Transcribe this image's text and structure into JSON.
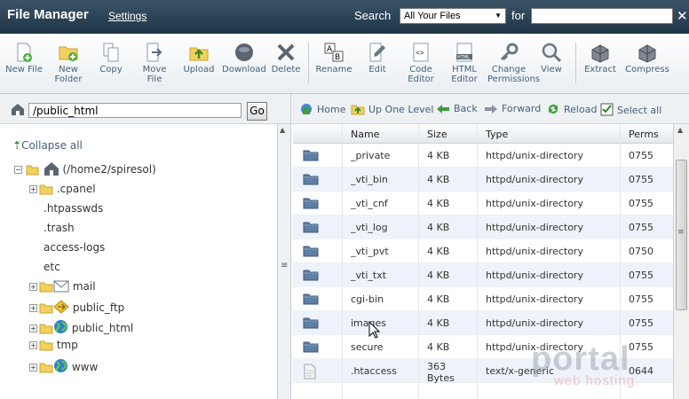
{
  "header": {
    "title": "File Manager",
    "settings": "Settings",
    "search_label": "Search",
    "search_scope": "All Your Files",
    "for_label": "for",
    "search_value": ""
  },
  "toolbar": [
    {
      "name": "new-file-button",
      "label": "New File",
      "icon": "new-file-icon"
    },
    {
      "name": "new-folder-button",
      "label": "New Folder",
      "icon": "new-folder-icon"
    },
    {
      "name": "copy-button",
      "label": "Copy",
      "icon": "copy-icon"
    },
    {
      "name": "move-file-button",
      "label": "Move File",
      "icon": "move-icon"
    },
    {
      "name": "upload-button",
      "label": "Upload",
      "icon": "upload-icon"
    },
    {
      "name": "download-button",
      "label": "Download",
      "icon": "download-icon"
    },
    {
      "name": "delete-button",
      "label": "Delete",
      "icon": "delete-icon"
    },
    {
      "name": "rename-button",
      "label": "Rename",
      "icon": "rename-icon"
    },
    {
      "name": "edit-button",
      "label": "Edit",
      "icon": "edit-icon"
    },
    {
      "name": "code-editor-button",
      "label": "Code Editor",
      "icon": "code-editor-icon"
    },
    {
      "name": "html-editor-button",
      "label": "HTML Editor",
      "icon": "html-editor-icon"
    },
    {
      "name": "change-permissions-button",
      "label": "Change Permissions",
      "icon": "key-icon"
    },
    {
      "name": "view-button",
      "label": "View",
      "icon": "magnifier-icon"
    },
    {
      "name": "extract-button",
      "label": "Extract",
      "icon": "extract-icon"
    },
    {
      "name": "compress-button",
      "label": "Compress",
      "icon": "compress-icon"
    }
  ],
  "pathbar": {
    "path": "/public_html",
    "go": "Go"
  },
  "nav": {
    "home": "Home",
    "up": "Up One Level",
    "back": "Back",
    "forward": "Forward",
    "reload": "Reload",
    "select_all": "Select all"
  },
  "tree": {
    "collapse_all": "Collapse all",
    "root": "(/home2/spiresol)",
    "items": [
      {
        "label": ".cpanel",
        "kind": "folder",
        "expandable": true
      },
      {
        "label": ".htpasswds",
        "kind": "plain",
        "expandable": false
      },
      {
        "label": ".trash",
        "kind": "plain",
        "expandable": false
      },
      {
        "label": "access-logs",
        "kind": "plain",
        "expandable": false
      },
      {
        "label": "etc",
        "kind": "plain",
        "expandable": false
      },
      {
        "label": "mail",
        "kind": "mail",
        "expandable": true
      },
      {
        "label": "public_ftp",
        "kind": "ftp",
        "expandable": true
      },
      {
        "label": "public_html",
        "kind": "globe",
        "expandable": true
      },
      {
        "label": "tmp",
        "kind": "folder",
        "expandable": true
      },
      {
        "label": "www",
        "kind": "globe",
        "expandable": true
      }
    ]
  },
  "table": {
    "columns": [
      "Name",
      "Size",
      "Type",
      "Perms"
    ],
    "rows": [
      {
        "name": "_private",
        "size": "4 KB",
        "type": "httpd/unix-directory",
        "perms": "0755"
      },
      {
        "name": "_vti_bin",
        "size": "4 KB",
        "type": "httpd/unix-directory",
        "perms": "0755"
      },
      {
        "name": "_vti_cnf",
        "size": "4 KB",
        "type": "httpd/unix-directory",
        "perms": "0755"
      },
      {
        "name": "_vti_log",
        "size": "4 KB",
        "type": "httpd/unix-directory",
        "perms": "0755"
      },
      {
        "name": "_vti_pvt",
        "size": "4 KB",
        "type": "httpd/unix-directory",
        "perms": "0750"
      },
      {
        "name": "_vti_txt",
        "size": "4 KB",
        "type": "httpd/unix-directory",
        "perms": "0755"
      },
      {
        "name": "cgi-bin",
        "size": "4 KB",
        "type": "httpd/unix-directory",
        "perms": "0755"
      },
      {
        "name": "images",
        "size": "4 KB",
        "type": "httpd/unix-directory",
        "perms": "0755"
      },
      {
        "name": "secure",
        "size": "4 KB",
        "type": "httpd/unix-directory",
        "perms": "0755"
      },
      {
        "name": ".htaccess",
        "size": "363 Bytes",
        "type": "text/x-generic",
        "perms": "0644"
      }
    ]
  },
  "watermark": {
    "big": "portal",
    "small": "web hosting"
  }
}
